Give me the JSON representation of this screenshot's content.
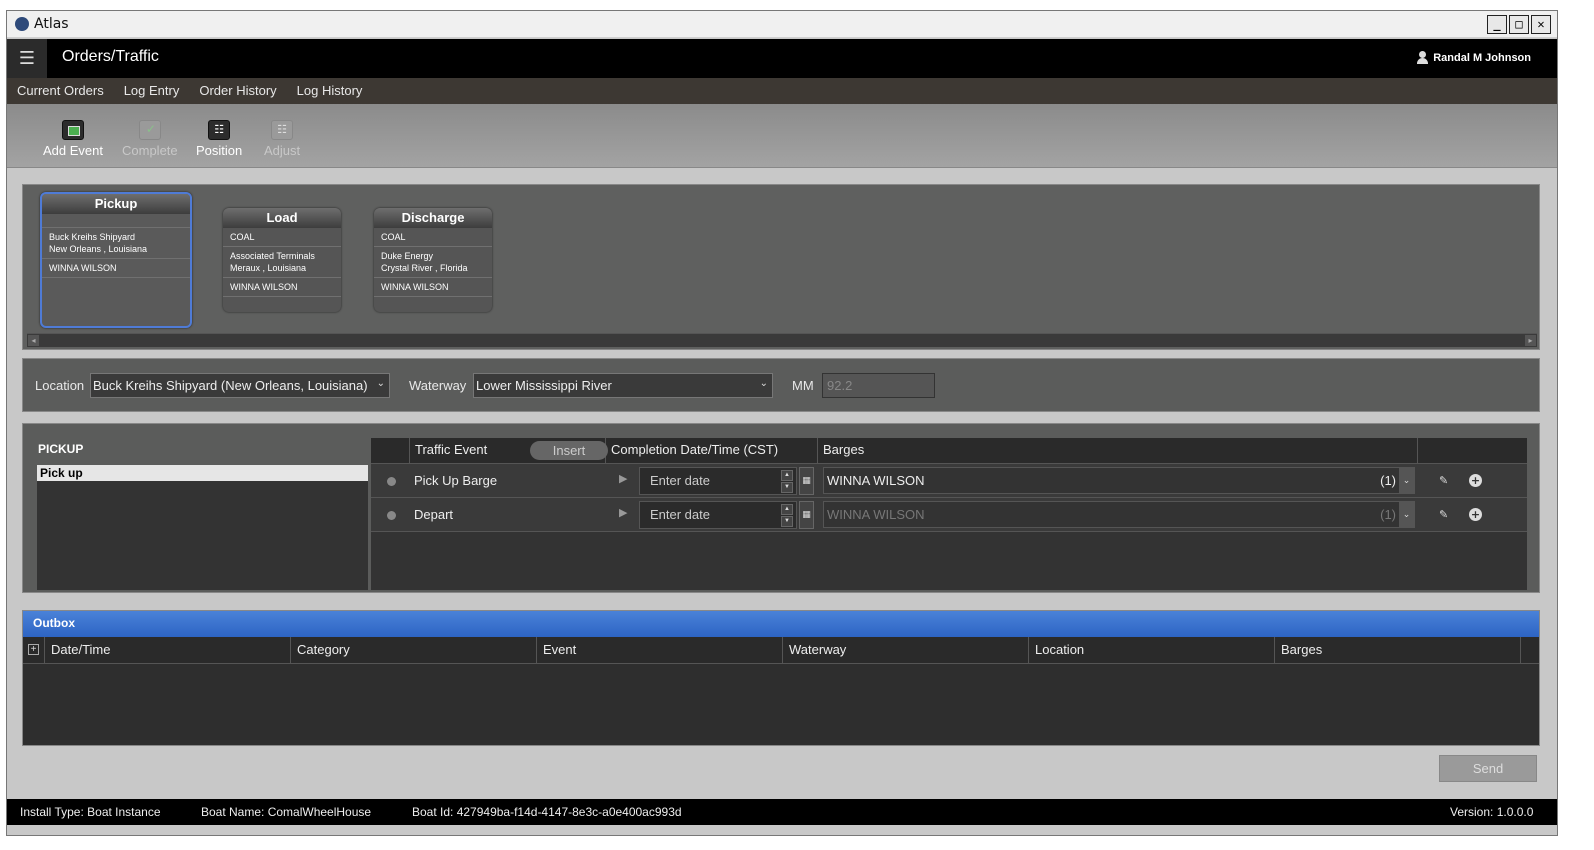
{
  "window": {
    "title": "Atlas"
  },
  "header": {
    "page_title": "Orders/Traffic",
    "user_name": "Randal M Johnson"
  },
  "nav": {
    "items": [
      "Current Orders",
      "Log Entry",
      "Order History",
      "Log History"
    ]
  },
  "toolbar": {
    "add_event": "Add Event",
    "complete": "Complete",
    "position": "Position",
    "adjust": "Adjust"
  },
  "events": [
    {
      "title": "Pickup",
      "commodity": "",
      "location_line1": "Buck Kreihs Shipyard",
      "location_line2": "New Orleans ,  Louisiana",
      "contact": "WINNA WILSON"
    },
    {
      "title": "Load",
      "commodity": "COAL",
      "location_line1": "Associated Terminals",
      "location_line2": "Meraux ,  Louisiana",
      "contact": "WINNA WILSON"
    },
    {
      "title": "Discharge",
      "commodity": "COAL",
      "location_line1": "Duke Energy",
      "location_line2": "Crystal River ,  Florida",
      "contact": "WINNA WILSON"
    }
  ],
  "location_bar": {
    "location_label": "Location",
    "location_value": "Buck Kreihs Shipyard (New Orleans, Louisiana)",
    "waterway_label": "Waterway",
    "waterway_value": "Lower Mississippi River",
    "mm_label": "MM",
    "mm_value": "92.2"
  },
  "pickup": {
    "title": "PICKUP",
    "list_items": [
      "Pick up"
    ],
    "columns": {
      "traffic_event": "Traffic Event",
      "insert": "Insert",
      "completion": "Completion Date/Time (CST)",
      "barges": "Barges"
    },
    "rows": [
      {
        "event": "Pick Up Barge",
        "date_placeholder": "Enter date",
        "barge": "WINNA WILSON",
        "count": "(1)"
      },
      {
        "event": "Depart",
        "date_placeholder": "Enter date",
        "barge": "WINNA WILSON",
        "count": "(1)"
      }
    ]
  },
  "outbox": {
    "title": "Outbox",
    "columns": [
      "Date/Time",
      "Category",
      "Event",
      "Waterway",
      "Location",
      "Barges"
    ]
  },
  "send_label": "Send",
  "status": {
    "install_type": "Install Type:  Boat Instance",
    "boat_name": "Boat Name:  ComalWheelHouse",
    "boat_id": "Boat Id:  427949ba-f14d-4147-8e3c-a0e400ac993d",
    "version": "Version:  1.0.0.0"
  }
}
